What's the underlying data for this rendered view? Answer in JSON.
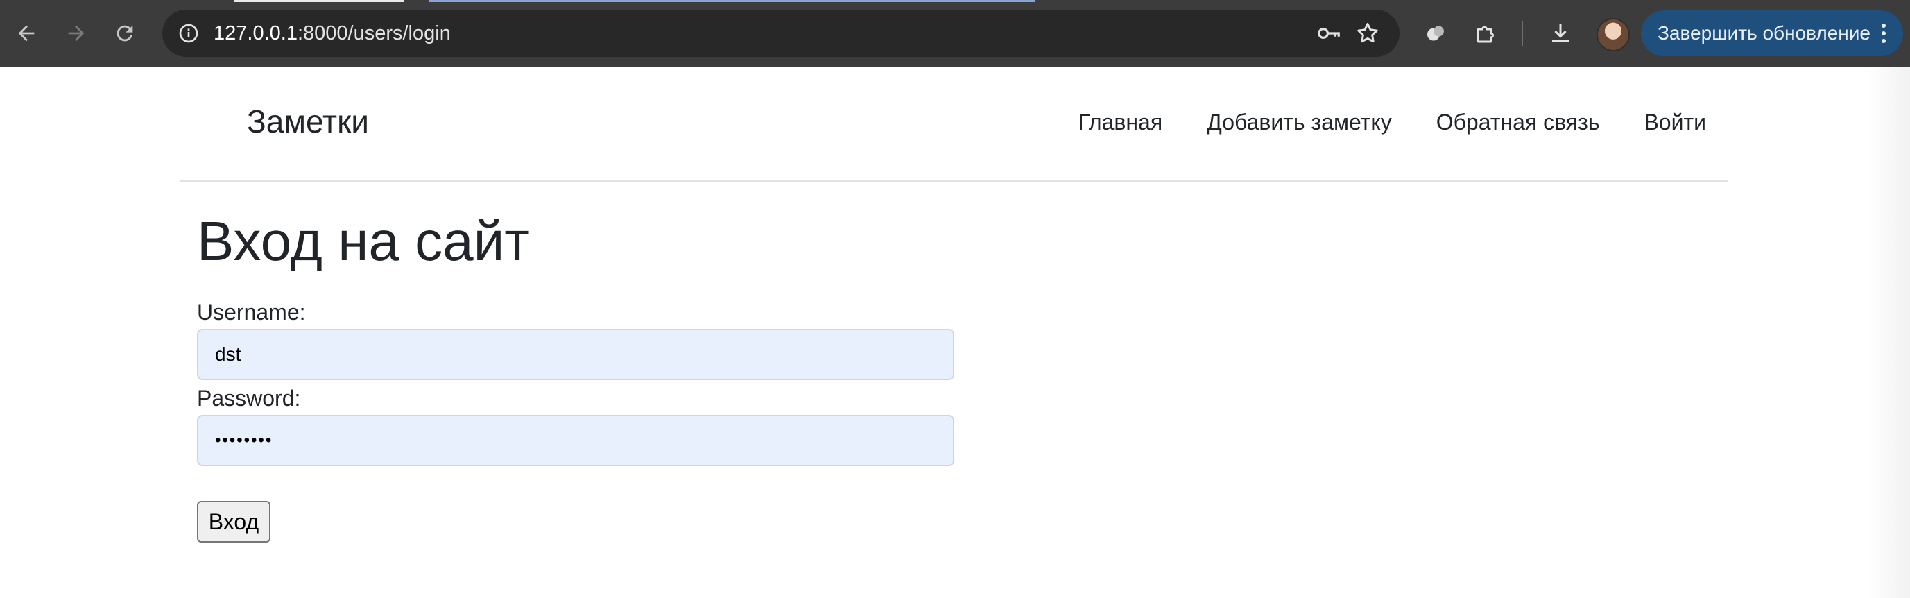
{
  "browser": {
    "address_bar": {
      "host": "127.0.0.1",
      "path": ":8000/users/login"
    },
    "update_button_label": "Завершить обновление",
    "icons": {
      "back": "arrow-left-icon",
      "forward": "arrow-right-icon",
      "reload": "reload-icon",
      "site_info": "info-icon",
      "password": "key-icon",
      "bookmark": "star-icon",
      "extension": "puzzle-icon",
      "download": "download-icon",
      "menu": "kebab-menu-icon"
    },
    "colors": {
      "chrome": "#3c3c3c",
      "omnibox": "#282828",
      "update_button": "#1f4f7d"
    }
  },
  "site": {
    "brand": "Заметки",
    "nav": [
      {
        "label": "Главная"
      },
      {
        "label": "Добавить заметку"
      },
      {
        "label": "Обратная связь"
      },
      {
        "label": "Войти"
      }
    ]
  },
  "login": {
    "title": "Вход на сайт",
    "username_label": "Username:",
    "username_value": "dst",
    "password_label": "Password:",
    "password_value": "••••••••",
    "submit_label": "Вход"
  }
}
